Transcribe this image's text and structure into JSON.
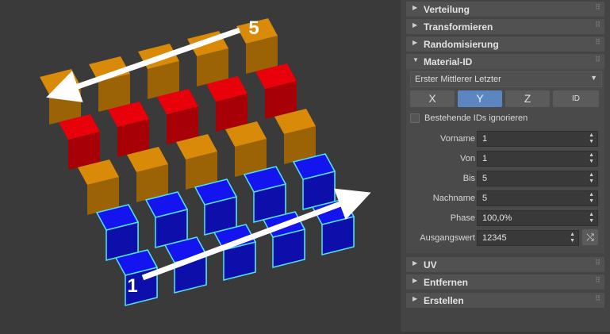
{
  "panel": {
    "rollouts_top": [
      {
        "label": "Verteilung",
        "icon": "triangle-right"
      },
      {
        "label": "Transformieren",
        "icon": "triangle-right"
      },
      {
        "label": "Randomisierung",
        "icon": "triangle-right"
      }
    ],
    "material_id": {
      "label": "Material-ID",
      "icon": "triangle-down",
      "mode_dropdown": "Erster Mittlerer Letzter",
      "axis_buttons": {
        "x": "X",
        "y": "Y",
        "z": "Z",
        "id": "ID",
        "active": "Y"
      },
      "ignore_existing": {
        "label": "Bestehende IDs ignorieren",
        "checked": false
      },
      "params": {
        "vorname": {
          "label": "Vorname",
          "value": "1"
        },
        "von": {
          "label": "Von",
          "value": "1"
        },
        "bis": {
          "label": "Bis",
          "value": "5"
        },
        "nachname": {
          "label": "Nachname",
          "value": "5"
        },
        "phase": {
          "label": "Phase",
          "value": "100,0%"
        },
        "ausgangswert": {
          "label": "Ausgangswert",
          "value": "12345"
        }
      }
    },
    "rollouts_bottom": [
      {
        "label": "UV",
        "icon": "triangle-right"
      },
      {
        "label": "Entfernen",
        "icon": "triangle-right"
      },
      {
        "label": "Erstellen",
        "icon": "triangle-right"
      }
    ],
    "grip_glyph": "⠿",
    "colors": {
      "active_button": "#5b86c2",
      "panel_bg": "#444444",
      "viewport_bg": "#3a3a3a"
    }
  },
  "viewport": {
    "start_label": "1",
    "end_label": "5",
    "grid_colors_rows_back_to_front": [
      [
        "orange",
        "orange",
        "orange",
        "orange",
        "orange"
      ],
      [
        "red",
        "red",
        "red",
        "red",
        "red"
      ],
      [
        "orange",
        "orange",
        "orange",
        "orange",
        "orange"
      ],
      [
        "blue",
        "blue",
        "blue",
        "blue",
        "blue"
      ],
      [
        "blue",
        "blue",
        "blue",
        "blue",
        "blue"
      ]
    ],
    "colors": {
      "red": "#e8000a",
      "orange": "#d88a08",
      "blue": "#1414ee",
      "selection_outline": "#4fe3ee",
      "arrow": "#ffffff"
    }
  }
}
